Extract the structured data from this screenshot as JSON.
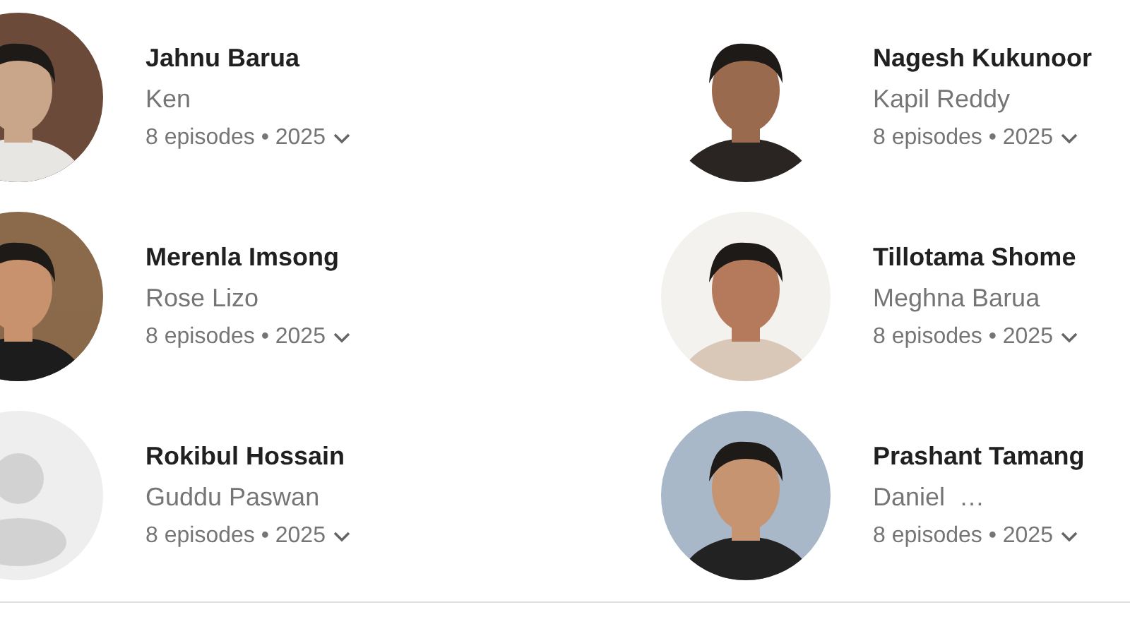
{
  "cast": [
    {
      "name": "Jahnu Barua",
      "role": "Ken",
      "episodes": "8 episodes • 2025",
      "kind": "picture"
    },
    {
      "name": "Nagesh Kukunoor",
      "role": "Kapil Reddy",
      "episodes": "8 episodes • 2025",
      "kind": "picture"
    },
    {
      "name": "Merenla Imsong",
      "role": "Rose Lizo",
      "episodes": "8 episodes • 2025",
      "kind": "picture"
    },
    {
      "name": "Tillotama Shome",
      "role": "Meghna Barua",
      "episodes": "8 episodes • 2025",
      "kind": "picture"
    },
    {
      "name": "Rokibul Hossain",
      "role": "Guddu Paswan",
      "episodes": "8 episodes • 2025",
      "kind": "placeholder"
    },
    {
      "name": "Prashant Tamang",
      "role": "Daniel  …",
      "episodes": "8 episodes • 2025",
      "kind": "picture"
    }
  ]
}
